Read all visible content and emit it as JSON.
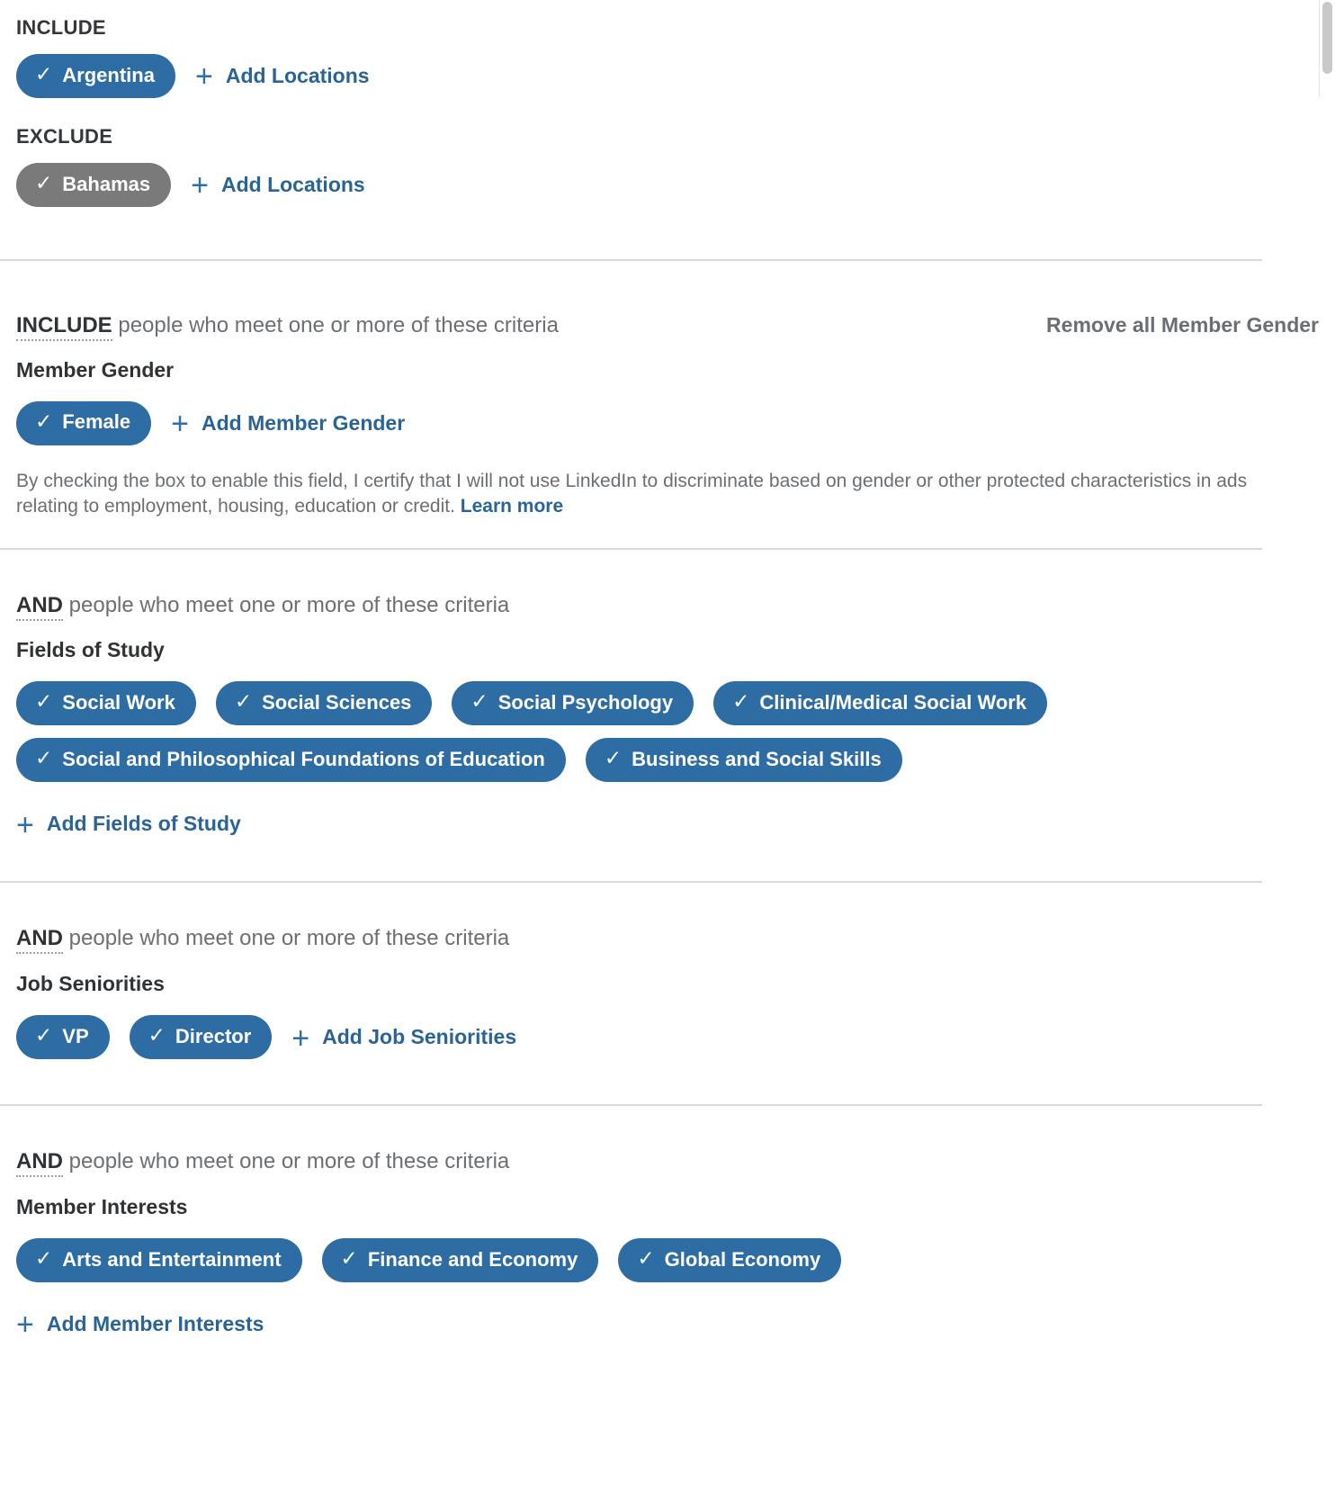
{
  "locations": {
    "include_label": "INCLUDE",
    "include_chips": [
      {
        "label": "Argentina",
        "tick": "check-icon",
        "state": "included"
      }
    ],
    "include_add": "Add Locations",
    "exclude_label": "EXCLUDE",
    "exclude_chips": [
      {
        "label": "Bahamas",
        "tick": "check-icon",
        "state": "excluded"
      }
    ],
    "exclude_add": "Add Locations"
  },
  "sections": [
    {
      "operator": "INCLUDE",
      "criteria_text": " people who meet one or more of these criteria",
      "remove_all": "Remove all Member Gender",
      "field_title": "Member Gender",
      "chips": [
        {
          "label": "Female"
        }
      ],
      "add_label": "Add Member Gender",
      "disclaimer": "By checking the box to enable this field, I certify that I will not use LinkedIn to discriminate based on gender or other protected characteristics in ads relating to employment, housing, education or credit. ",
      "disclaimer_link": "Learn more"
    },
    {
      "operator": "AND",
      "criteria_text": " people who meet one or more of these criteria",
      "field_title": "Fields of Study",
      "chips": [
        {
          "label": "Social Work"
        },
        {
          "label": "Social Sciences"
        },
        {
          "label": "Social Psychology"
        },
        {
          "label": "Clinical/Medical Social Work"
        },
        {
          "label": "Social and Philosophical Foundations of Education"
        },
        {
          "label": "Business and Social Skills"
        }
      ],
      "add_label": "Add Fields of Study"
    },
    {
      "operator": "AND",
      "criteria_text": " people who meet one or more of these criteria",
      "field_title": "Job Seniorities",
      "chips": [
        {
          "label": "VP"
        },
        {
          "label": "Director"
        }
      ],
      "add_label": "Add Job Seniorities"
    },
    {
      "operator": "AND",
      "criteria_text": " people who meet one or more of these criteria",
      "field_title": "Member Interests",
      "chips": [
        {
          "label": "Arts and Entertainment"
        },
        {
          "label": "Finance and Economy"
        },
        {
          "label": "Global Economy"
        }
      ],
      "add_label": "Add Member Interests"
    }
  ],
  "icons": {
    "check": "✓",
    "plus": "+"
  },
  "colors": {
    "chip_blue": "#2e6ca4",
    "chip_grey": "#7a7a7a",
    "link_blue": "#2a6496",
    "text_grey": "#6b6f73",
    "divider": "#d9d9d9"
  }
}
